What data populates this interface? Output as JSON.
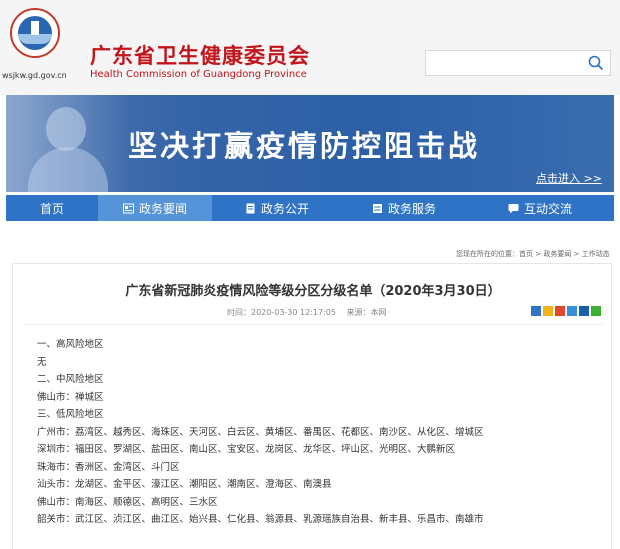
{
  "header": {
    "domain": "wsjkw.gd.gov.cn",
    "title": "广东省卫生健康委员会",
    "subtitle": "Health Commission of Guangdong Province",
    "search_placeholder": ""
  },
  "banner": {
    "title": "坚决打赢疫情防控阻击战",
    "link": "点击进入 >>"
  },
  "nav": {
    "items": [
      {
        "label": "首页",
        "icon": "",
        "active": false
      },
      {
        "label": "政务要闻",
        "icon": "news-icon",
        "active": true
      },
      {
        "label": "政务公开",
        "icon": "document-icon",
        "active": false
      },
      {
        "label": "政务服务",
        "icon": "service-icon",
        "active": false
      },
      {
        "label": "互动交流",
        "icon": "chat-icon",
        "active": false
      }
    ]
  },
  "breadcrumb": {
    "prefix": "您现在所在的位置：",
    "path": "首页 > 政务要闻 > 工作动态"
  },
  "article": {
    "title": "广东省新冠肺炎疫情风险等级分区分级名单（2020年3月30日）",
    "time_label": "时间：2020-03-30 12:17:05",
    "source_label": "来源：本网",
    "lines": [
      "一、高风险地区",
      "无",
      "二、中风险地区",
      "佛山市：禅城区",
      "三、低风险地区",
      "广州市：荔湾区、越秀区、海珠区、天河区、白云区、黄埔区、番禺区、花都区、南沙区、从化区、增城区",
      "深圳市：福田区、罗湖区、盐田区、南山区、宝安区、龙岗区、龙华区、坪山区、光明区、大鹏新区",
      "珠海市：香洲区、金湾区、斗门区",
      "汕头市：龙湖区、金平区、濠江区、潮阳区、潮南区、澄海区、南澳县",
      "佛山市：南海区、顺德区、高明区、三水区",
      "韶关市：武江区、浈江区、曲江区、始兴县、仁化县、翁源县、乳源瑶族自治县、新丰县、乐昌市、南雄市"
    ]
  },
  "colors": {
    "brand_red": "#c2141b",
    "nav_blue": "#2e73c6",
    "nav_active": "#5594d8",
    "banner_blue": "#2c5fa6"
  }
}
